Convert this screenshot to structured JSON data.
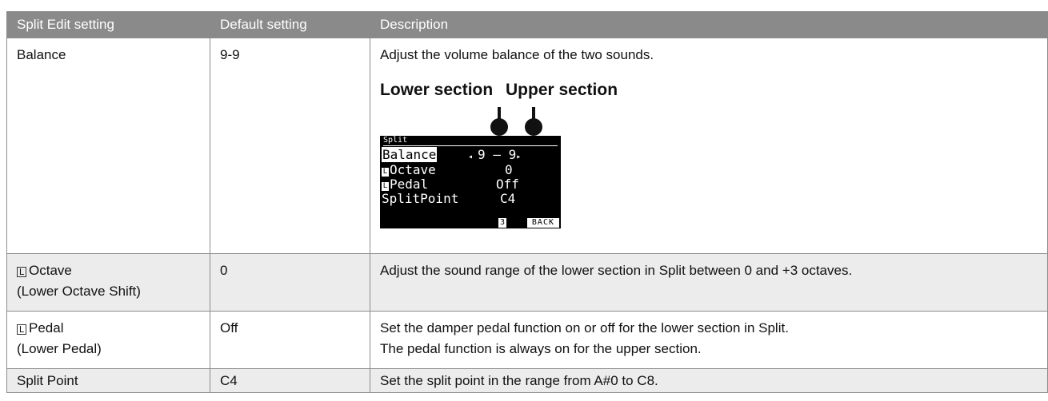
{
  "headers": {
    "col1": "Split Edit setting",
    "col2": "Default setting",
    "col3": "Description"
  },
  "rows": [
    {
      "setting": "Balance",
      "default": "9-9",
      "description": "Adjust the volume balance of the two sounds."
    },
    {
      "setting_icon": "L",
      "setting": "Octave",
      "setting_sub": "(Lower Octave Shift)",
      "default": "0",
      "description": "Adjust the sound range of the lower section in Split between 0 and +3 octaves."
    },
    {
      "setting_icon": "L",
      "setting": "Pedal",
      "setting_sub": "(Lower Pedal)",
      "default": "Off",
      "description": "Set the damper pedal function on or off for the lower section in Split.",
      "description2": "The pedal function is always on for the upper section."
    },
    {
      "setting": "Split Point",
      "default": "C4",
      "description": "Set the split point in the range from A#0 to C8."
    }
  ],
  "figure": {
    "lower_label": "Lower section",
    "upper_label": "Upper section",
    "lcd": {
      "title": "Split",
      "balance_label": "Balance",
      "balance_value": "9 – 9",
      "octave_icon": "L",
      "octave_label": "Octave",
      "octave_value": "0",
      "pedal_icon": "L",
      "pedal_label": "Pedal",
      "pedal_value": "Off",
      "splitpoint_label": "SplitPoint",
      "splitpoint_value": "C4",
      "back_num": "3",
      "back_label": "BACK"
    }
  }
}
